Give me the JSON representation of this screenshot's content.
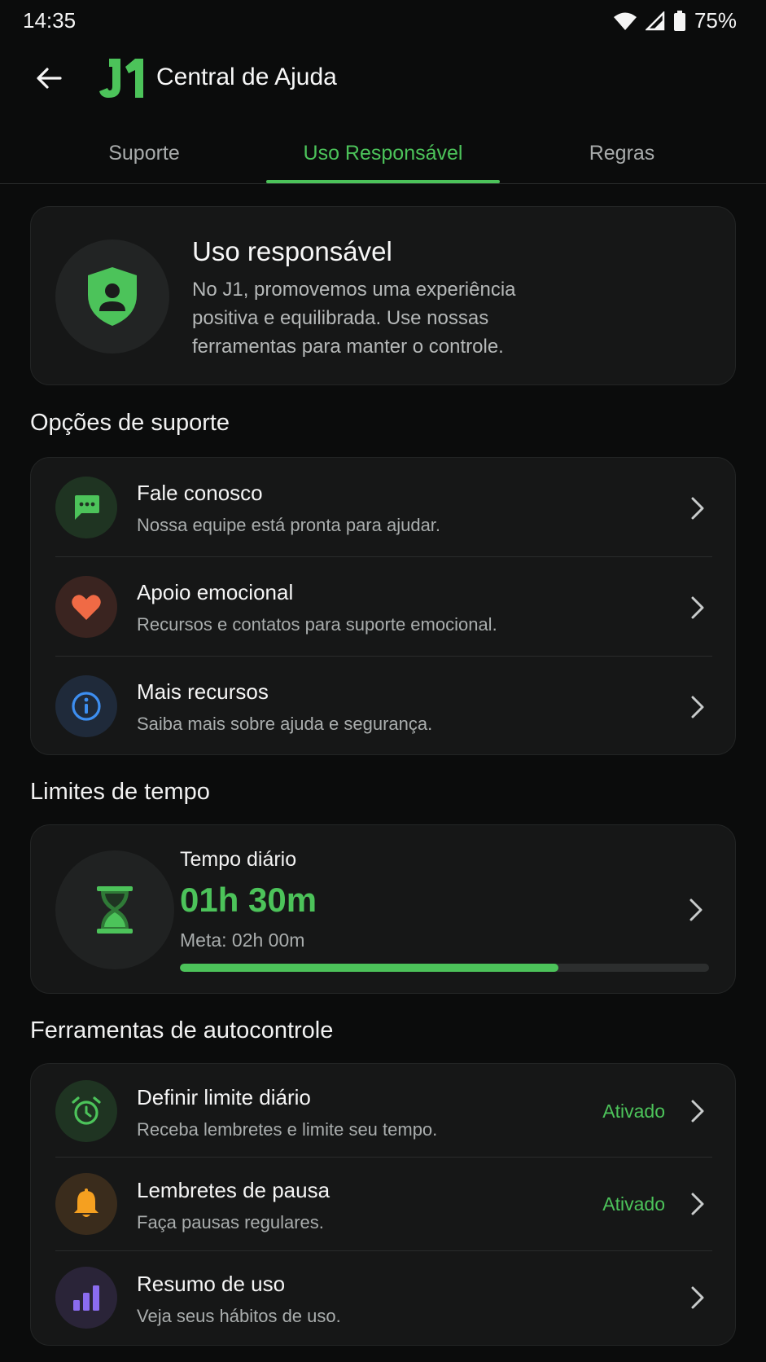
{
  "status_bar": {
    "time": "14:35",
    "battery": "75%"
  },
  "header": {
    "title": "Central de Ajuda",
    "logo_text": "J1"
  },
  "tabs": [
    {
      "label": "Suporte",
      "active": false
    },
    {
      "label": "Uso Responsável",
      "active": true
    },
    {
      "label": "Regras",
      "active": false
    }
  ],
  "hero": {
    "title": "Uso responsável",
    "description": "No J1, promovemos uma experiência positiva e equilibrada. Use nossas ferramentas para manter o controle.",
    "icon": "shield-user-icon"
  },
  "support_section": {
    "title": "Opções de suporte",
    "items": [
      {
        "title": "Fale conosco",
        "subtitle": "Nossa equipe está pronta para ajudar.",
        "icon": "chat-icon",
        "color": "#4cc35a"
      },
      {
        "title": "Apoio emocional",
        "subtitle": "Recursos e contatos para suporte emocional.",
        "icon": "heart-icon",
        "color": "#f06a45"
      },
      {
        "title": "Mais recursos",
        "subtitle": "Saiba mais sobre ajuda e segurança.",
        "icon": "info-icon",
        "color": "#3d8ef0"
      }
    ]
  },
  "time_section": {
    "title": "Limites de tempo",
    "label": "Tempo diário",
    "value": "01h 30m",
    "goal": "Meta: 02h 00m",
    "progress": 0.715
  },
  "tools_section": {
    "title": "Ferramentas de autocontrole",
    "items": [
      {
        "title": "Definir limite diário",
        "subtitle": "Receba lembretes e limite seu tempo.",
        "status": "Ativado",
        "icon": "alarm-clock-icon",
        "color": "#4cc35a"
      },
      {
        "title": "Lembretes de pausa",
        "subtitle": "Faça pausas regulares.",
        "status": "Ativado",
        "icon": "bell-icon",
        "color": "#f5a020"
      },
      {
        "title": "Resumo de uso",
        "subtitle": "Veja seus hábitos de uso.",
        "status": "",
        "icon": "bar-chart-icon",
        "color": "#8b6cf0"
      }
    ]
  },
  "colors": {
    "accent": "#4cc35a",
    "background": "#0b0c0c",
    "card": "#161717"
  }
}
